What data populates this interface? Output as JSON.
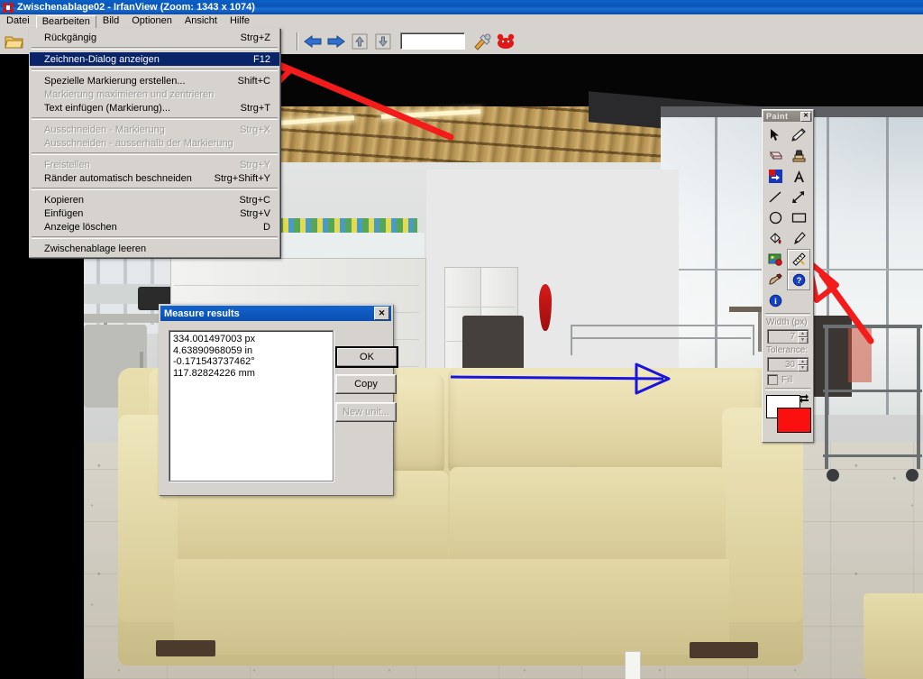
{
  "window": {
    "title": "Zwischenablage02 - IrfanView (Zoom: 1343 x 1074)",
    "app_icon": "irfanview-logo-icon"
  },
  "menubar": {
    "items": [
      {
        "label": "Datei",
        "open": false
      },
      {
        "label": "Bearbeiten",
        "open": true
      },
      {
        "label": "Bild",
        "open": false
      },
      {
        "label": "Optionen",
        "open": false
      },
      {
        "label": "Ansicht",
        "open": false
      },
      {
        "label": "Hilfe",
        "open": false
      }
    ]
  },
  "toolbar": {
    "buttons": [
      {
        "name": "open-folder-icon",
        "glyph": "folder"
      },
      {
        "name": "back-arrow-icon",
        "glyph": "left-arrow"
      },
      {
        "name": "forward-arrow-icon",
        "glyph": "right-arrow"
      },
      {
        "name": "move-up-icon",
        "glyph": "up-arrow"
      },
      {
        "name": "move-down-icon",
        "glyph": "down-arrow"
      },
      {
        "name": "settings-tools-icon",
        "glyph": "tools"
      },
      {
        "name": "irfanview-mascot-icon",
        "glyph": "red-mascot"
      }
    ],
    "path_field_value": "",
    "path_field_placeholder": ""
  },
  "edit_menu": {
    "title": "Bearbeiten",
    "groups": [
      [
        {
          "label": "Rückgängig",
          "accel": "Strg+Z",
          "disabled": false,
          "selected": false
        }
      ],
      [
        {
          "label": "Zeichnen-Dialog anzeigen",
          "accel": "F12",
          "disabled": false,
          "selected": true
        }
      ],
      [
        {
          "label": "Spezielle Markierung erstellen...",
          "accel": "Shift+C",
          "disabled": false,
          "selected": false
        },
        {
          "label": "Markierung maximieren und zentrieren",
          "accel": "",
          "disabled": true,
          "selected": false
        },
        {
          "label": "Text einfügen (Markierung)...",
          "accel": "Strg+T",
          "disabled": false,
          "selected": false
        }
      ],
      [
        {
          "label": "Ausschneiden - Markierung",
          "accel": "Strg+X",
          "disabled": true,
          "selected": false
        },
        {
          "label": "Ausschneiden - ausserhalb der Markierung",
          "accel": "",
          "disabled": true,
          "selected": false
        }
      ],
      [
        {
          "label": "Freistellen",
          "accel": "Strg+Y",
          "disabled": true,
          "selected": false
        },
        {
          "label": "Ränder automatisch beschneiden",
          "accel": "Strg+Shift+Y",
          "disabled": false,
          "selected": false
        }
      ],
      [
        {
          "label": "Kopieren",
          "accel": "Strg+C",
          "disabled": false,
          "selected": false
        },
        {
          "label": "Einfügen",
          "accel": "Strg+V",
          "disabled": false,
          "selected": false
        },
        {
          "label": "Anzeige löschen",
          "accel": "D",
          "disabled": false,
          "selected": false
        }
      ],
      [
        {
          "label": "Zwischenablage leeren",
          "accel": "",
          "disabled": false,
          "selected": false
        }
      ]
    ]
  },
  "measure_dialog": {
    "title": "Measure results",
    "close_label": "✕",
    "results": [
      "334.001497003 px",
      "4.63890968059 in",
      "-0.171543737462°",
      "117.82824226 mm"
    ],
    "buttons": [
      {
        "label": "OK",
        "name": "ok-button",
        "disabled": false,
        "default": true
      },
      {
        "label": "Copy",
        "name": "copy-button",
        "disabled": false,
        "default": false
      },
      {
        "label": "New unit...",
        "name": "new-unit-button",
        "disabled": true,
        "default": false
      }
    ]
  },
  "paint_panel": {
    "title": "Paint",
    "close_label": "✕",
    "tools": [
      {
        "name": "pointer-select-icon",
        "glyph": "pointer",
        "active": false
      },
      {
        "name": "pencil-icon",
        "glyph": "pencil",
        "active": false
      },
      {
        "name": "eraser-icon",
        "glyph": "eraser",
        "active": false
      },
      {
        "name": "stamp-clone-icon",
        "glyph": "stamp",
        "active": false
      },
      {
        "name": "replace-color-icon",
        "glyph": "replace-color",
        "active": false
      },
      {
        "name": "text-tool-icon",
        "glyph": "text-a",
        "active": false
      },
      {
        "name": "line-tool-icon",
        "glyph": "line",
        "active": false
      },
      {
        "name": "arrow-tool-icon",
        "glyph": "arrow",
        "active": false
      },
      {
        "name": "ellipse-tool-icon",
        "glyph": "circle",
        "active": false
      },
      {
        "name": "rectangle-tool-icon",
        "glyph": "rect",
        "active": false
      },
      {
        "name": "fill-bucket-icon",
        "glyph": "bucket",
        "active": false
      },
      {
        "name": "color-picker-icon",
        "glyph": "dropper",
        "active": false
      },
      {
        "name": "insert-image-icon",
        "glyph": "image",
        "active": false
      },
      {
        "name": "measure-tool-icon",
        "glyph": "measure",
        "active": true
      },
      {
        "name": "blur-smudge-icon",
        "glyph": "smudge",
        "active": false
      },
      {
        "name": "help-tool-icon",
        "glyph": "help",
        "active": true
      },
      {
        "name": "info-tool-icon",
        "glyph": "info",
        "active": false
      }
    ],
    "width_label": "Width (px)",
    "width_value": "7",
    "tolerance_label": "Tolerance:",
    "tolerance_value": "30",
    "fill_label": "Fill",
    "fill_checked": false,
    "background_color": "#ffffff",
    "foreground_color": "#fb0f0f",
    "swap_icon": "swap-colors-icon"
  },
  "annotations": {
    "red_color": "#f41b1b",
    "blue_color": "#1a14e0",
    "items": [
      {
        "name": "red-annotation-arrow-menu",
        "target": "Zeichnen-Dialog anzeigen"
      },
      {
        "name": "red-annotation-arrow-paint",
        "target": "measure-tool-icon"
      },
      {
        "name": "blue-measure-line-arrow",
        "target": "sofa-back-measurement"
      }
    ]
  },
  "photo": {
    "name": "furniture-showroom-photo",
    "description": "Beige leather sofa in a furniture showroom"
  }
}
